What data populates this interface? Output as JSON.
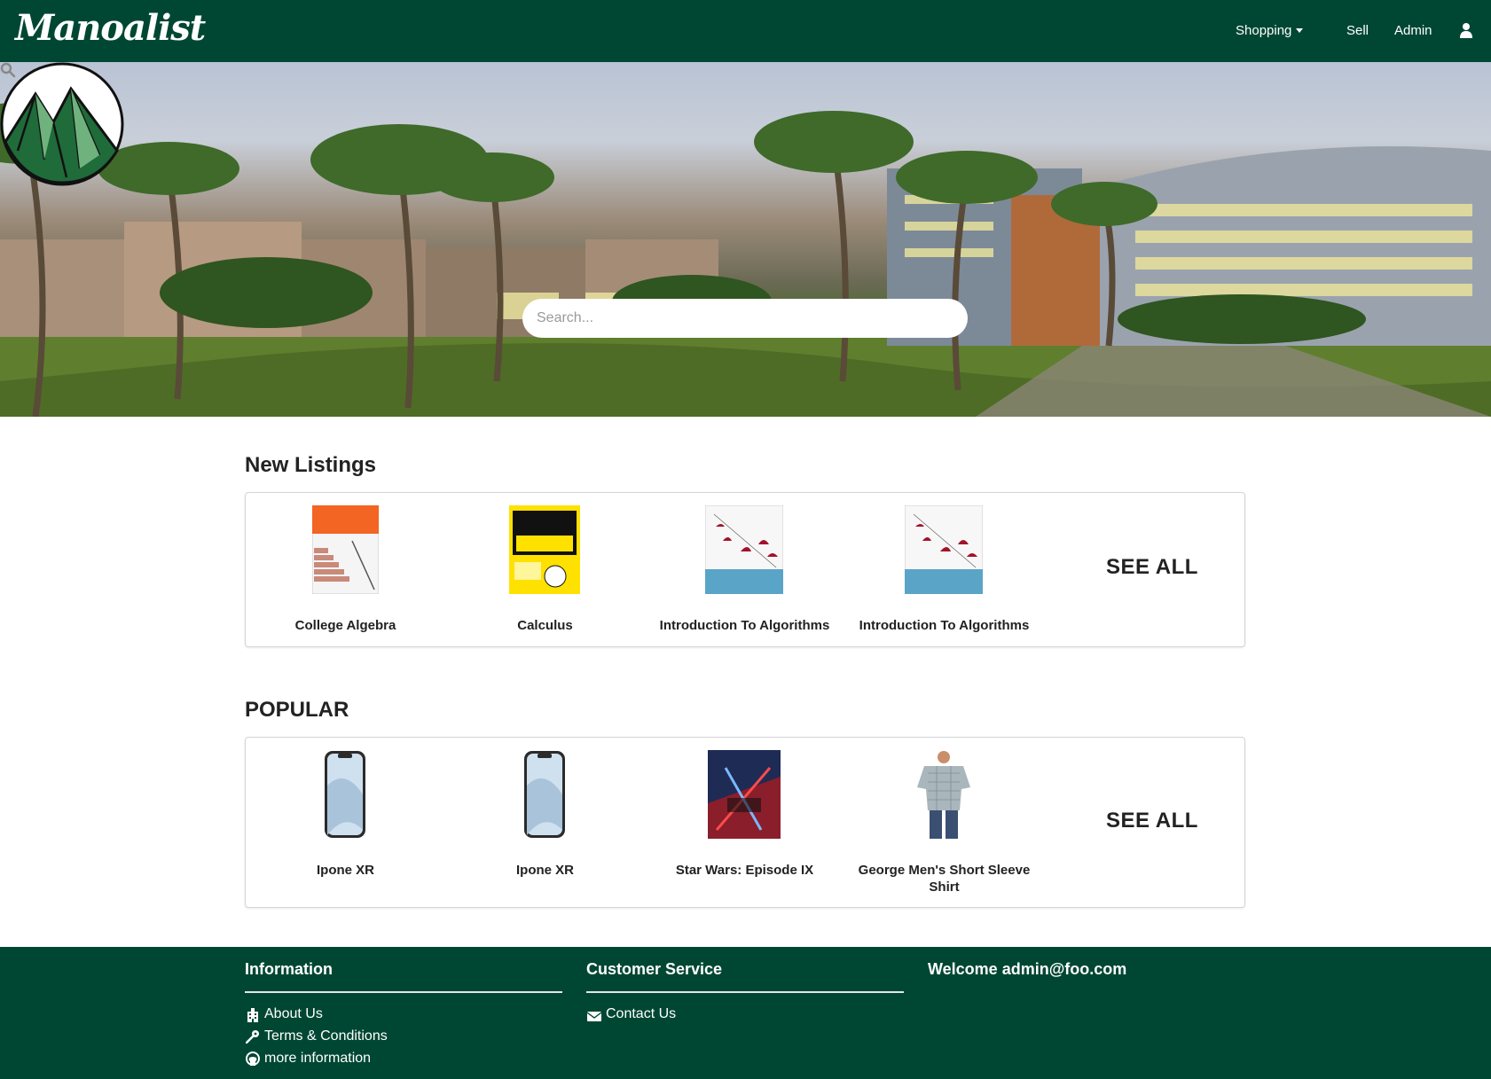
{
  "navbar": {
    "brand": "Manoalist",
    "shopping_label": "Shopping",
    "sell_label": "Sell",
    "admin_label": "Admin"
  },
  "hero": {
    "search_placeholder": "Search..."
  },
  "new_listings": {
    "title": "New Listings",
    "items": [
      {
        "label": "College Algebra"
      },
      {
        "label": "Calculus"
      },
      {
        "label": "Introduction To Algorithms"
      },
      {
        "label": "Introduction To Algorithms"
      }
    ],
    "see_all": "SEE ALL"
  },
  "popular": {
    "title": "POPULAR",
    "items": [
      {
        "label": "Ipone XR"
      },
      {
        "label": "Ipone XR"
      },
      {
        "label": "Star Wars: Episode IX"
      },
      {
        "label": "George Men's Short Sleeve Shirt"
      }
    ],
    "see_all": "SEE ALL"
  },
  "footer": {
    "information": {
      "heading": "Information",
      "links": [
        "About Us",
        "Terms & Conditions",
        "more information"
      ]
    },
    "customer_service": {
      "heading": "Customer Service",
      "links": [
        "Contact Us"
      ]
    },
    "welcome": "Welcome admin@foo.com"
  },
  "colors": {
    "brand_green": "#004733",
    "logo_green_dark": "#1f6b3a",
    "logo_green_light": "#6fb27d"
  }
}
